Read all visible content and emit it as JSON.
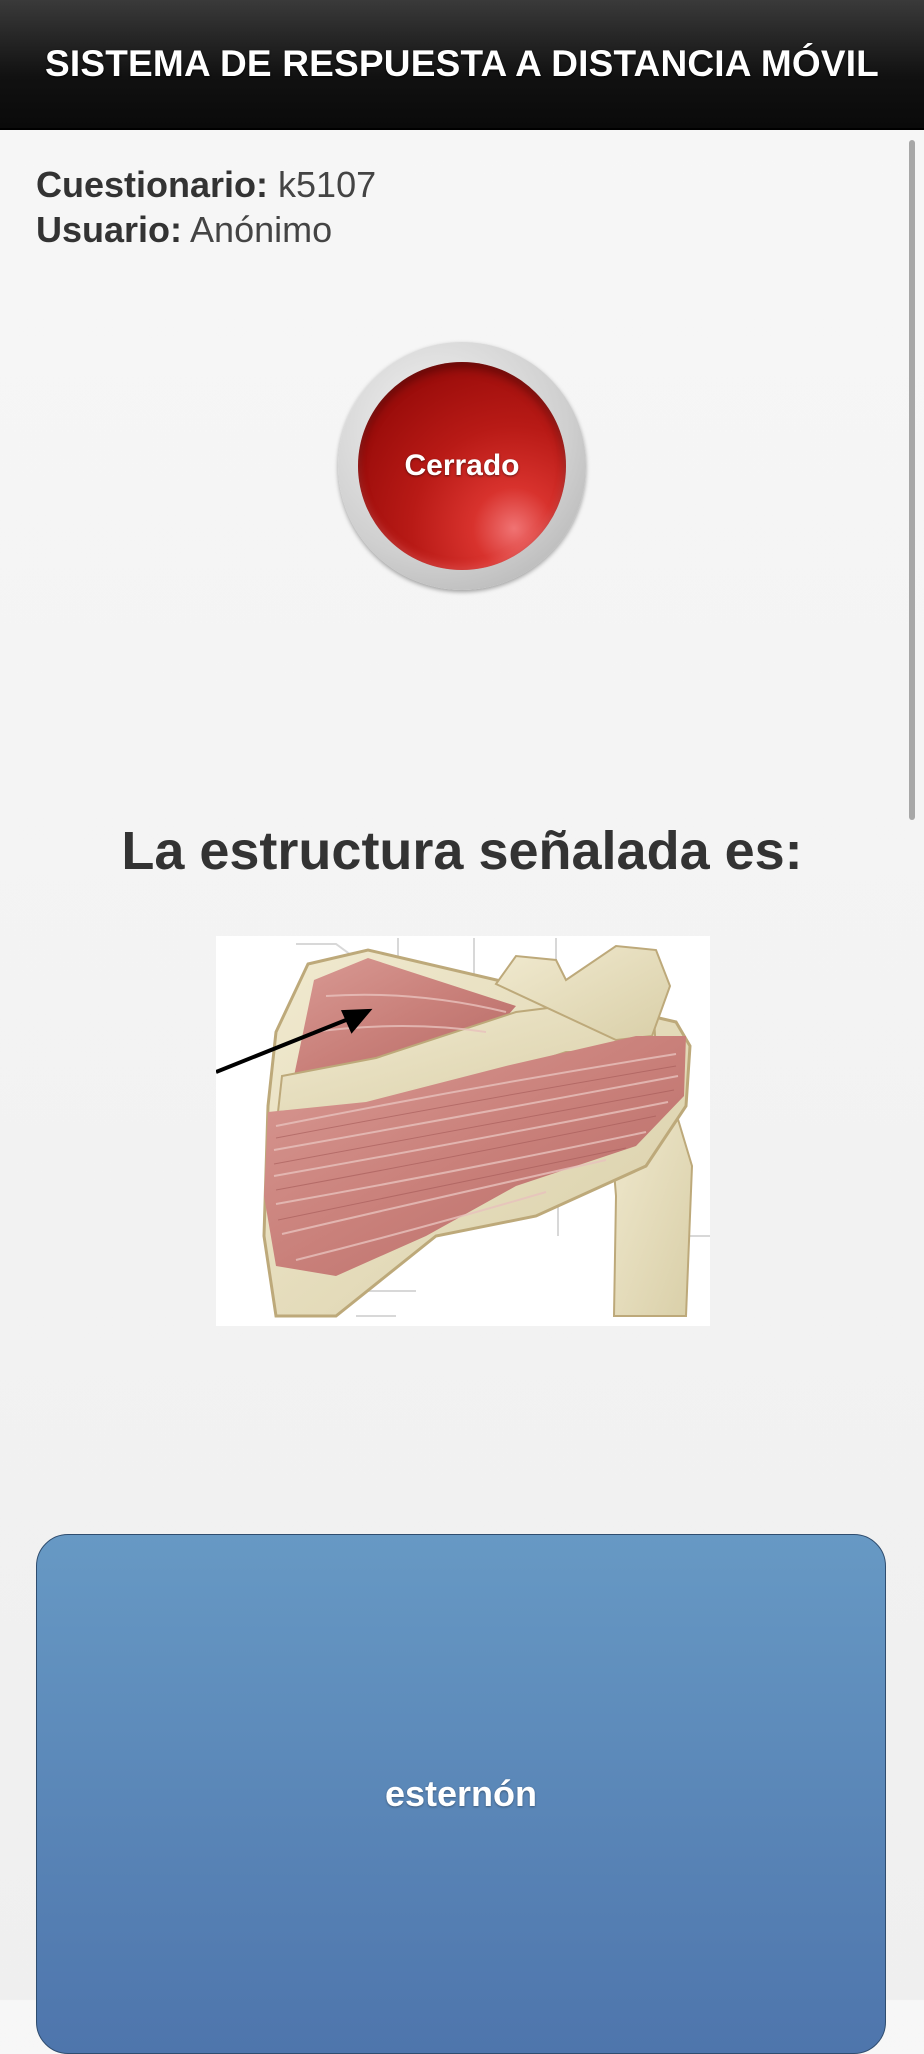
{
  "header": {
    "title": "SISTEMA DE RESPUESTA A DISTANCIA MÓVIL"
  },
  "meta": {
    "quiz_label": "Cuestionario:",
    "quiz_value": "k5107",
    "user_label": "Usuario:",
    "user_value": "Anónimo"
  },
  "status": {
    "label": "Cerrado",
    "color": "#b81a16"
  },
  "question": {
    "text": "La estructura señalada es:"
  },
  "figure": {
    "subject": "shoulder-muscle-anatomy-illustration"
  },
  "answers": [
    {
      "label": "esternón",
      "color": "#5b86b9"
    }
  ]
}
